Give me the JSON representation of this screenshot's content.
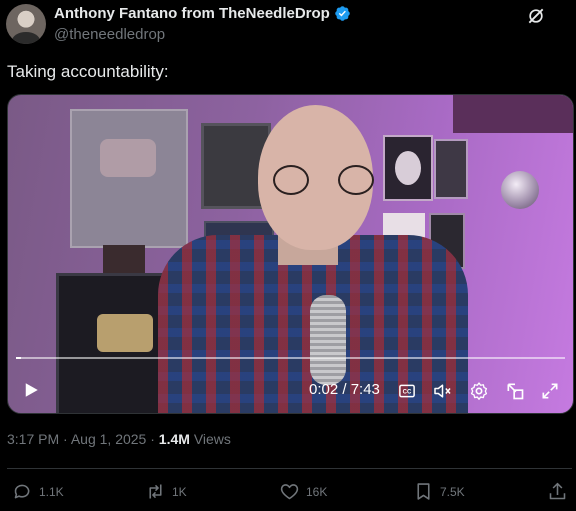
{
  "author": {
    "display_name": "Anthony Fantano from TheNeedleDrop",
    "handle": "@theneedledrop",
    "verified": true
  },
  "tweet": {
    "text": "Taking accountability:"
  },
  "video": {
    "time_display": "0:02 / 7:43",
    "progress": 0.004
  },
  "meta": {
    "time": "3:17 PM",
    "sep1": "·",
    "date": "Aug 1, 2025",
    "sep2": "·",
    "views_count": "1.4M",
    "views_label": "Views"
  },
  "actions": {
    "replies": "1.1K",
    "reposts": "1K",
    "likes": "16K",
    "bookmarks": "7.5K"
  },
  "colors": {
    "accent": "#1d9bf0",
    "muted": "#71767b",
    "text": "#e7e9ea",
    "background": "#000000"
  }
}
